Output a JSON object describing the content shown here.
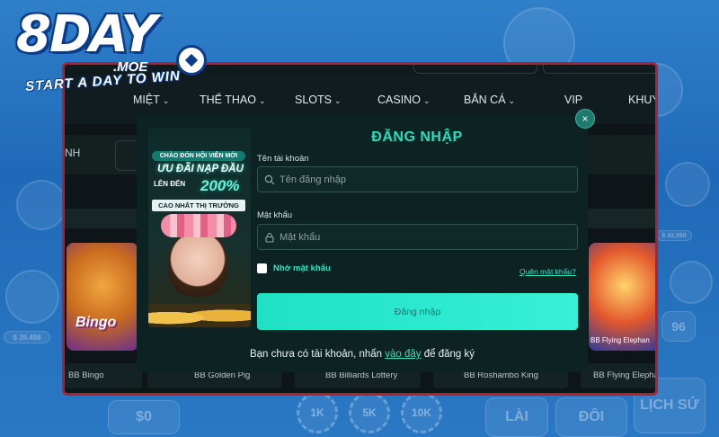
{
  "logo": {
    "brand": "8DAY",
    "domain": ".MOE",
    "tagline": "START A DAY TO WIN"
  },
  "nav": {
    "items": [
      {
        "label": "THỂ THAO",
        "has_chevron": true
      },
      {
        "label": "SLOTS",
        "has_chevron": true
      },
      {
        "label": "CASINO",
        "has_chevron": true
      },
      {
        "label": "BẮN CÁ",
        "has_chevron": true
      },
      {
        "label": "VIP",
        "has_chevron": false
      },
      {
        "label": "KHUYẾ",
        "has_chevron": false
      }
    ],
    "partial_left": "MIỆT"
  },
  "subbar": {
    "partial_label": "NH"
  },
  "games": [
    {
      "label": "BB Bingo",
      "card_text": "Bingo"
    },
    {
      "label": "BB Golden Pig"
    },
    {
      "label": "BB Billiards Lottery"
    },
    {
      "label": "BB Roshambo King"
    },
    {
      "label": "BB Flying Elephan",
      "card_text": "BB Flying Elephan"
    }
  ],
  "banner": {
    "line1": "CHÀO ĐÓN HỘI VIÊN MỚI",
    "line2": "ƯU ĐÃI NẠP ĐẦU",
    "line3": "LÊN ĐẾN",
    "percent": "200%",
    "line4": "CAO NHẤT THỊ TRƯỜNG"
  },
  "login": {
    "title": "ĐĂNG NHẬP",
    "username_label": "Tên tài khoản",
    "username_placeholder": "Tên đăng nhập",
    "password_label": "Mật khẩu",
    "password_placeholder": "Mật khẩu",
    "remember_label": "Nhớ mật khẩu",
    "remember_checked": false,
    "forgot_label": "Quên mật khẩu?",
    "submit_label": "Đăng nhập",
    "register_prefix": "Bạn chưa có tài khoản, nhấn",
    "register_link": "vào đây",
    "register_suffix": "để đăng ký",
    "close_symbol": "×"
  },
  "background": {
    "tiles": [
      "$0",
      "LÀI",
      "ĐÔI",
      "LỊCH SỬ",
      "96",
      "1K",
      "5K",
      "10K"
    ],
    "chip_values": [
      "$ 39.458",
      "$ 43.560"
    ]
  },
  "colors": {
    "accent": "#22e0c0",
    "frame_border": "#b31f2f",
    "modal_bg": "#0d2222",
    "button_bg": "#2ee8ce",
    "page_bg": "#2a78c4"
  }
}
